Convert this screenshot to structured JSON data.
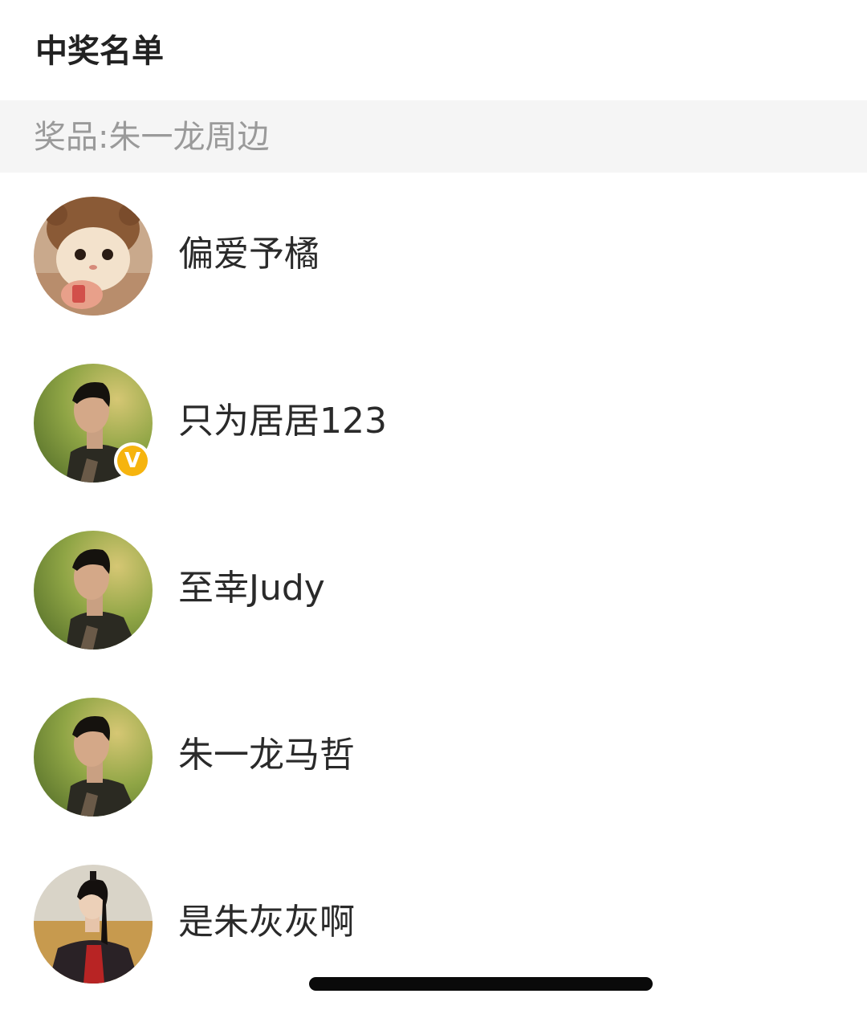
{
  "header": {
    "title": "中奖名单"
  },
  "prize": {
    "text": "奖品:朱一龙周边"
  },
  "winners": [
    {
      "name": "偏爱予橘",
      "avatar": "cat-avatar-icon",
      "verified": false
    },
    {
      "name": "只为居居123",
      "avatar": "boy-profile-avatar-icon",
      "verified": true
    },
    {
      "name": "至幸Judy",
      "avatar": "boy-profile-avatar-icon",
      "verified": false
    },
    {
      "name": "朱一龙马哲",
      "avatar": "boy-profile-avatar-icon",
      "verified": false
    },
    {
      "name": "是朱灰灰啊",
      "avatar": "costume-character-avatar-icon",
      "verified": false
    }
  ],
  "badge": {
    "letter": "V",
    "color": "#f6b40e"
  }
}
